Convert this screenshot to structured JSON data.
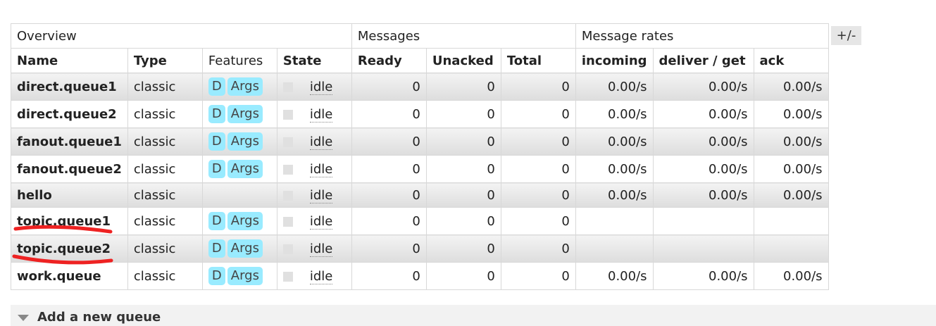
{
  "table": {
    "groups": [
      "Overview",
      "Messages",
      "Message rates"
    ],
    "columns": [
      "Name",
      "Type",
      "Features",
      "State",
      "Ready",
      "Unacked",
      "Total",
      "incoming",
      "deliver / get",
      "ack"
    ],
    "rows": [
      {
        "name": "direct.queue1",
        "type": "classic",
        "features": [
          "D",
          "Args"
        ],
        "state": "idle",
        "ready": "0",
        "unacked": "0",
        "total": "0",
        "incoming": "0.00/s",
        "deliver": "0.00/s",
        "ack": "0.00/s"
      },
      {
        "name": "direct.queue2",
        "type": "classic",
        "features": [
          "D",
          "Args"
        ],
        "state": "idle",
        "ready": "0",
        "unacked": "0",
        "total": "0",
        "incoming": "0.00/s",
        "deliver": "0.00/s",
        "ack": "0.00/s"
      },
      {
        "name": "fanout.queue1",
        "type": "classic",
        "features": [
          "D",
          "Args"
        ],
        "state": "idle",
        "ready": "0",
        "unacked": "0",
        "total": "0",
        "incoming": "0.00/s",
        "deliver": "0.00/s",
        "ack": "0.00/s"
      },
      {
        "name": "fanout.queue2",
        "type": "classic",
        "features": [
          "D",
          "Args"
        ],
        "state": "idle",
        "ready": "0",
        "unacked": "0",
        "total": "0",
        "incoming": "0.00/s",
        "deliver": "0.00/s",
        "ack": "0.00/s"
      },
      {
        "name": "hello",
        "type": "classic",
        "features": [],
        "state": "idle",
        "ready": "0",
        "unacked": "0",
        "total": "0",
        "incoming": "0.00/s",
        "deliver": "0.00/s",
        "ack": "0.00/s"
      },
      {
        "name": "topic.queue1",
        "type": "classic",
        "features": [
          "D",
          "Args"
        ],
        "state": "idle",
        "ready": "0",
        "unacked": "0",
        "total": "0",
        "incoming": "",
        "deliver": "",
        "ack": ""
      },
      {
        "name": "topic.queue2",
        "type": "classic",
        "features": [
          "D",
          "Args"
        ],
        "state": "idle",
        "ready": "0",
        "unacked": "0",
        "total": "0",
        "incoming": "",
        "deliver": "",
        "ack": ""
      },
      {
        "name": "work.queue",
        "type": "classic",
        "features": [
          "D",
          "Args"
        ],
        "state": "idle",
        "ready": "0",
        "unacked": "0",
        "total": "0",
        "incoming": "0.00/s",
        "deliver": "0.00/s",
        "ack": "0.00/s"
      }
    ]
  },
  "columns_toggle_label": "+/-",
  "add_queue_label": "Add a new queue",
  "colors": {
    "feature_tag": "#99ebff",
    "annotation_stroke": "#ee2222",
    "row_alt": "#e6e6e6"
  }
}
